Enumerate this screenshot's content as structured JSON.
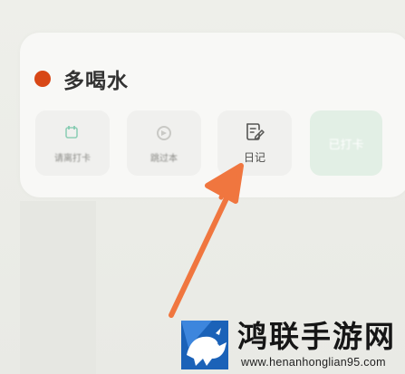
{
  "task": {
    "title": "多喝水",
    "dot_color": "#d84716"
  },
  "actions": [
    {
      "label": "请离打卡",
      "icon": "calendar-check-icon"
    },
    {
      "label": "跳过本",
      "icon": "skip-icon"
    },
    {
      "label": "日记",
      "icon": "edit-note-icon"
    },
    {
      "label": "已打卡",
      "icon": ""
    }
  ],
  "annotation": {
    "arrow_color": "#f0763f",
    "icon": "pointer-arrow-icon"
  },
  "watermark": {
    "brand": "鸿联手游网",
    "domain": "www.henanhonglian95.com",
    "logo_color": "#1b62b8"
  }
}
